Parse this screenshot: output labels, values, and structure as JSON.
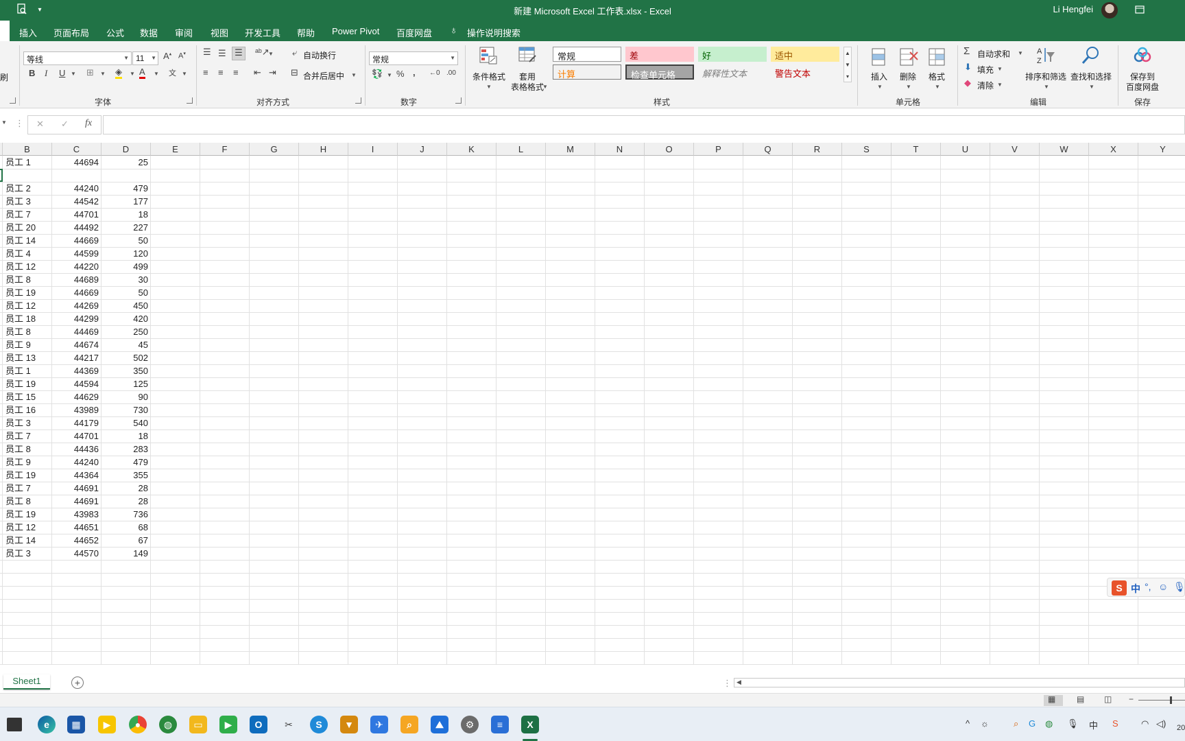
{
  "window": {
    "title": "新建 Microsoft Excel 工作表.xlsx  -  Excel",
    "user": "Li Hengfei"
  },
  "menu": [
    "插入",
    "页面布局",
    "公式",
    "数据",
    "审阅",
    "视图",
    "开发工具",
    "帮助",
    "Power Pivot",
    "百度网盘",
    "操作说明搜索"
  ],
  "ribbon": {
    "font": {
      "name": "等线",
      "size": "11",
      "label": "字体"
    },
    "alignment": {
      "wrap_text": "自动换行",
      "merge_center": "合并后居中",
      "label": "对齐方式"
    },
    "number": {
      "format": "常规",
      "label": "数字"
    },
    "styles": {
      "conditional_format": "条件格式",
      "table_format": "套用\n表格格式",
      "cells": [
        "常规",
        "差",
        "好",
        "适中",
        "计算",
        "检查单元格",
        "解释性文本",
        "警告文本"
      ],
      "label": "样式"
    },
    "cells_group": {
      "insert": "插入",
      "delete": "删除",
      "format": "格式",
      "label": "单元格"
    },
    "editing": {
      "autosum": "自动求和",
      "fill": "填充",
      "clear": "清除",
      "sort_filter": "排序和筛选",
      "find_select": "查找和选择",
      "label": "编辑"
    },
    "save": {
      "save_to_baidu": "保存到\n百度网盘",
      "label": "保存"
    },
    "left_partial": "刷"
  },
  "formula_bar": {
    "cancel": "✕",
    "confirm": "✓",
    "fx": "fx",
    "value": ""
  },
  "columns": [
    "B",
    "C",
    "D",
    "E",
    "F",
    "G",
    "H",
    "I",
    "J",
    "K",
    "L",
    "M",
    "N",
    "O",
    "P",
    "Q",
    "R",
    "S",
    "T",
    "U",
    "V",
    "W",
    "X",
    "Y"
  ],
  "rows": [
    [
      "员工 1",
      "44694",
      "25"
    ],
    [
      "",
      "",
      ""
    ],
    [
      "员工 2",
      "44240",
      "479"
    ],
    [
      "员工 3",
      "44542",
      "177"
    ],
    [
      "员工 7",
      "44701",
      "18"
    ],
    [
      "员工 20",
      "44492",
      "227"
    ],
    [
      "员工 14",
      "44669",
      "50"
    ],
    [
      "员工 4",
      "44599",
      "120"
    ],
    [
      "员工 12",
      "44220",
      "499"
    ],
    [
      "员工 8",
      "44689",
      "30"
    ],
    [
      "员工 19",
      "44669",
      "50"
    ],
    [
      "员工 12",
      "44269",
      "450"
    ],
    [
      "员工 18",
      "44299",
      "420"
    ],
    [
      "员工 8",
      "44469",
      "250"
    ],
    [
      "员工 9",
      "44674",
      "45"
    ],
    [
      "员工 13",
      "44217",
      "502"
    ],
    [
      "员工 1",
      "44369",
      "350"
    ],
    [
      "员工 19",
      "44594",
      "125"
    ],
    [
      "员工 15",
      "44629",
      "90"
    ],
    [
      "员工 16",
      "43989",
      "730"
    ],
    [
      "员工 3",
      "44179",
      "540"
    ],
    [
      "员工 7",
      "44701",
      "18"
    ],
    [
      "员工 8",
      "44436",
      "283"
    ],
    [
      "员工 9",
      "44240",
      "479"
    ],
    [
      "员工 19",
      "44364",
      "355"
    ],
    [
      "员工 7",
      "44691",
      "28"
    ],
    [
      "员工 8",
      "44691",
      "28"
    ],
    [
      "员工 19",
      "43983",
      "736"
    ],
    [
      "员工 12",
      "44651",
      "68"
    ],
    [
      "员工 14",
      "44652",
      "67"
    ],
    [
      "员工 3",
      "44570",
      "149"
    ]
  ],
  "sheet": {
    "name": "Sheet1",
    "add": "+"
  },
  "ime": {
    "logo": "S",
    "mode": "中"
  },
  "tray": {
    "lang": "中",
    "clock_partial": "20"
  },
  "colors": {
    "excel_green": "#217346",
    "bad_bg": "#ffc7ce",
    "good_bg": "#c6efce",
    "neutral_bg": "#ffeb9c",
    "calc_text": "#fa7d00",
    "warn_text": "#c00000"
  }
}
